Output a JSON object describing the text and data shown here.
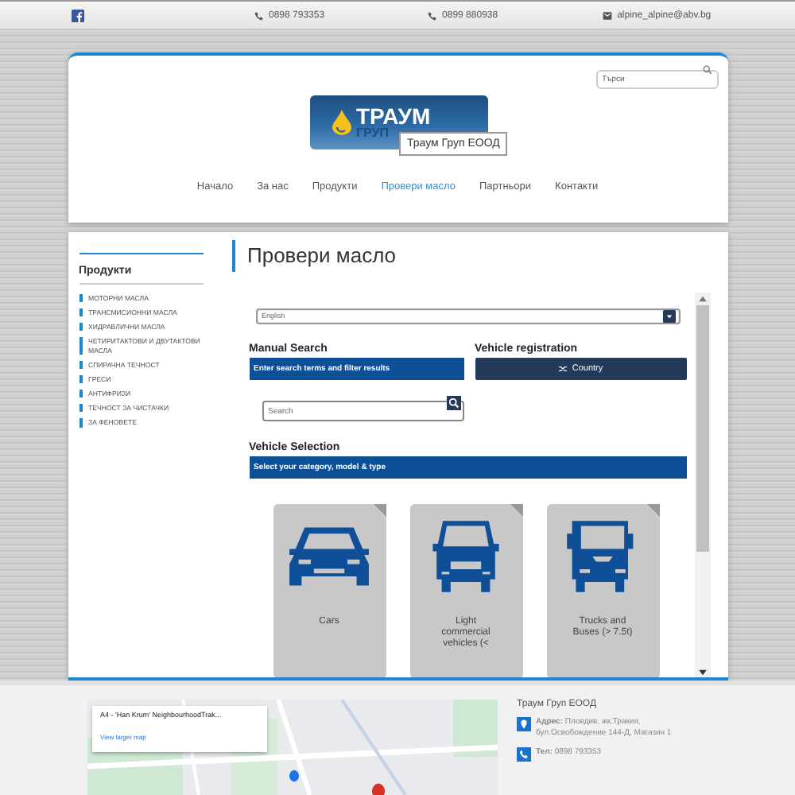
{
  "top_bar": {
    "phone_1": "0898 793353",
    "phone_2": "0899 880938",
    "email": "alpine_alpine@abv.bg"
  },
  "header": {
    "search": {
      "placeholder": "Търси"
    },
    "logo": {
      "line_1": "ТРАУМ",
      "line_2": "ГРУП"
    },
    "tooltip": "Траум Груп ЕООД",
    "nav": [
      {
        "label": "Начало",
        "selected": false
      },
      {
        "label": "За нас",
        "selected": false
      },
      {
        "label": "Продукти",
        "selected": false
      },
      {
        "label": "Провери масло",
        "selected": true
      },
      {
        "label": "Партньори",
        "selected": false
      },
      {
        "label": "Контакти",
        "selected": false
      }
    ]
  },
  "sidebar": {
    "title": "Продукти",
    "items": [
      "МОТОРНИ МАСЛА",
      "ТРАНСМИСИОННИ МАСЛА",
      "ХИДРАВЛИЧНИ МАСЛА",
      "ЧЕТИРИТАКТОВИ И ДВУТАКТОВИ МАСЛА",
      "СПИРАЧНА ТЕЧНОСТ",
      "ГРЕСИ",
      "АНТИФРИЗИ",
      "ТЕЧНОСТ ЗА ЧИСТАЧКИ",
      "ЗА ФЕНОВЕТЕ"
    ]
  },
  "page_title": "Провери масло",
  "oil_widget": {
    "language": "English",
    "manual_search": {
      "title": "Manual Search",
      "banner": "Enter search terms and filter results",
      "search_placeholder": "Search"
    },
    "vehicle_registration": {
      "title": "Vehicle registration",
      "button": "Country"
    },
    "vehicle_selection": {
      "title": "Vehicle Selection",
      "banner": "Select your category, model & type",
      "categories": [
        {
          "kind": "car",
          "label": "Cars"
        },
        {
          "kind": "van",
          "label": "Light commercial vehicles (<"
        },
        {
          "kind": "truck",
          "label": "Trucks and Buses (> 7.5t)"
        }
      ]
    }
  },
  "footer": {
    "map_info": {
      "title": "A4 - 'Han Krum' NeighbourhoodTrak...",
      "link": "View larger map"
    },
    "company": "Траум Груп ЕООД",
    "address": "**Адрес:** Пловдив, жк.Тракия, бул.Освобождение 144-Д, Магазин 1",
    "phone": "**Тел:** 0898 793353"
  }
}
